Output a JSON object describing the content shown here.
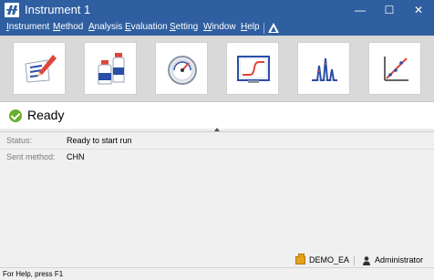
{
  "window": {
    "title": "Instrument 1",
    "min_glyph": "—",
    "max_glyph": "☐",
    "close_glyph": "✕"
  },
  "menu": {
    "items": [
      {
        "underline": "I",
        "rest": "nstrument"
      },
      {
        "underline": "M",
        "rest": "ethod"
      },
      {
        "underline": "A",
        "rest": "nalysis"
      },
      {
        "underline": "E",
        "rest": "valuation"
      },
      {
        "underline": "S",
        "rest": "etting"
      },
      {
        "underline": "W",
        "rest": "indow"
      },
      {
        "underline": "H",
        "rest": "elp"
      }
    ]
  },
  "toolbar": {
    "buttons": [
      {
        "icon": "method-edit-icon"
      },
      {
        "icon": "sample-bottles-icon"
      },
      {
        "icon": "gauge-icon"
      },
      {
        "icon": "monitor-curve-icon"
      },
      {
        "icon": "chromatogram-peaks-icon"
      },
      {
        "icon": "calibration-chart-icon"
      }
    ]
  },
  "state": {
    "status_icon": "check-circle-icon",
    "title": "Ready"
  },
  "details": {
    "status_label": "Status:",
    "status_value": "Ready to start run",
    "method_label": "Sent method:",
    "method_value": "CHN"
  },
  "session": {
    "database": "DEMO_EA",
    "user": "Administrator"
  },
  "footer": {
    "help_text": "For Help, press F1"
  },
  "colors": {
    "title_bar": "#2f5fa0",
    "toolbar_bg": "#d9d9d9",
    "ready_green": "#6aae2e",
    "icon_red": "#e0453a",
    "icon_blue": "#2b4ea8"
  }
}
